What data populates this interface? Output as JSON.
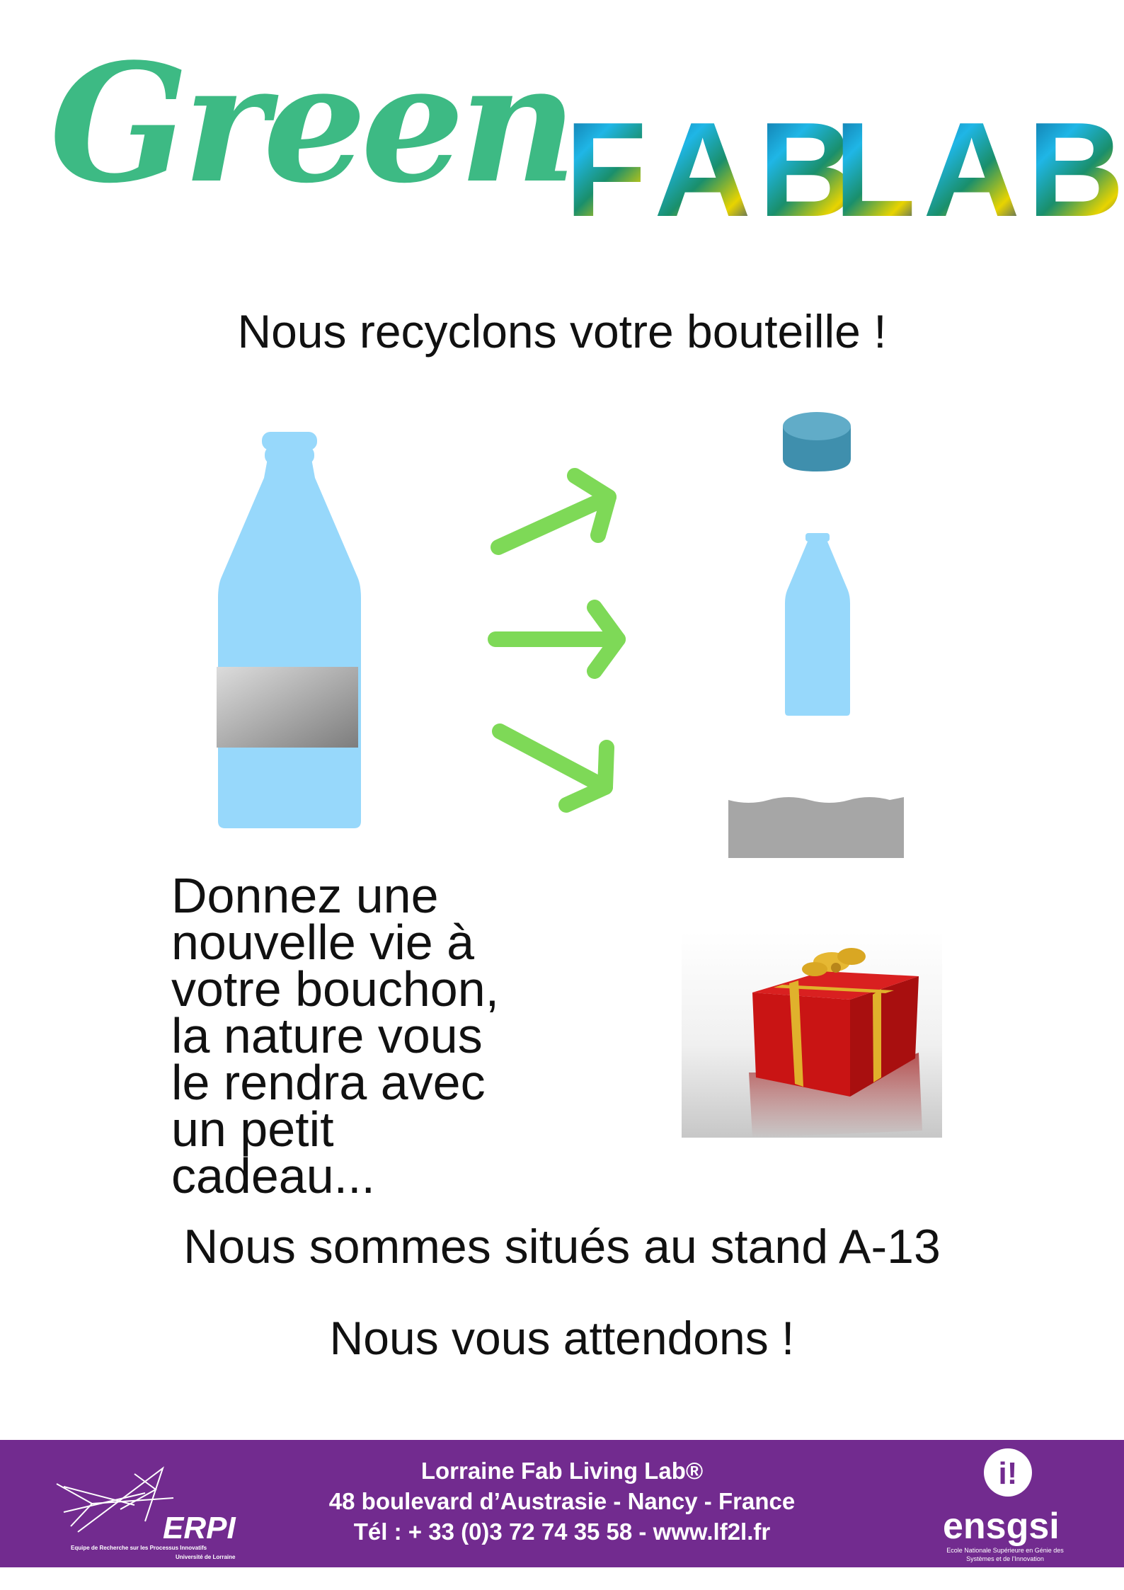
{
  "logo": {
    "green_word": "Green",
    "fab_letters": [
      "F",
      "A",
      "B"
    ],
    "lab_letters": [
      "L",
      "A",
      "B"
    ]
  },
  "headline": "Nous recyclons votre bouteille !",
  "body_lines": [
    "Donnez une",
    "nouvelle vie à",
    "votre bouchon,",
    "la nature vous",
    "le rendra avec",
    "un petit",
    "cadeau..."
  ],
  "stand": "Nous sommes situés au stand A-13",
  "wait": "Nous vous attendons !",
  "footer": {
    "line1": "Lorraine Fab Living Lab®",
    "line2": "48 boulevard d’Austrasie - Nancy - France",
    "line3": "Tél : + 33 (0)3 72 74 35 58 - www.lf2l.fr",
    "erpi_logo": "ERPI",
    "erpi_sub1": "Equipe de Recherche sur les Processus Innovatifs",
    "erpi_sub2": "Université de Lorraine",
    "ensgsi_logo": "ensgsi",
    "ensgsi_sub": "Ecole Nationale Supérieure en Génie des Systèmes et de l'Innovation"
  },
  "colors": {
    "green_logo": "#3dba84",
    "arrow_green": "#7ed957",
    "bottle_blue": "#97d8fb",
    "cap_teal": "#4a9ab8",
    "footer_purple": "#722b8f",
    "label_grey": "#999999"
  },
  "icons": {
    "bottle": "bottle-icon",
    "arrows": "arrow-icon",
    "cap": "cap-icon",
    "small_bottle": "small-bottle-icon",
    "label": "label-strip-icon",
    "gift": "gift-icon"
  }
}
